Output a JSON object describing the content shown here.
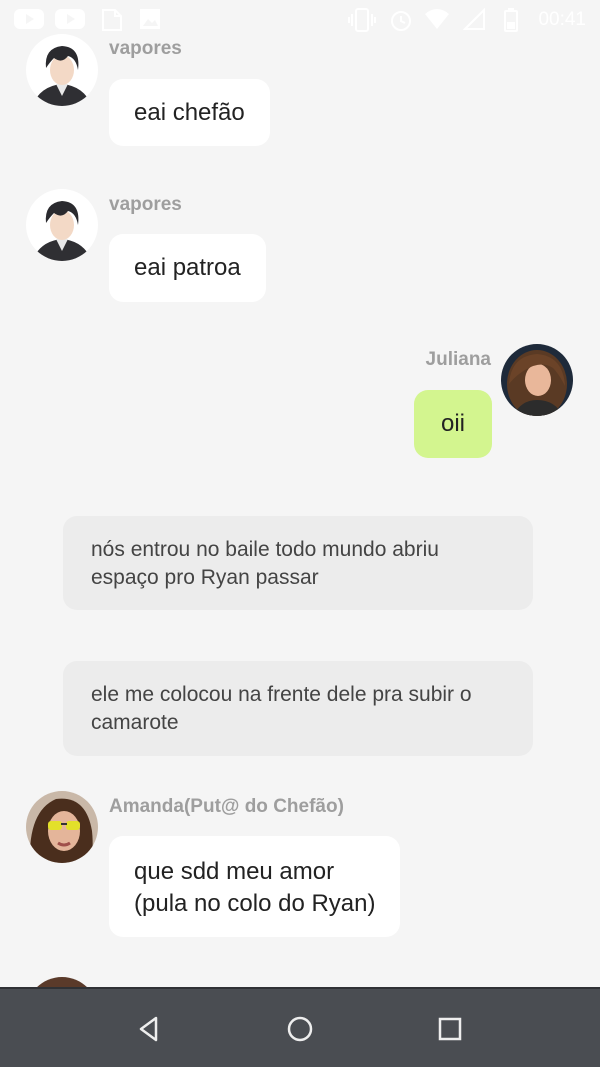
{
  "status_bar": {
    "time": "00:41",
    "icons": [
      "youtube-icon",
      "youtube-icon",
      "file-icon",
      "image-icon",
      "vibrate-icon",
      "alarm-icon",
      "wifi-icon",
      "signal-icon",
      "battery-icon"
    ]
  },
  "messages": [
    {
      "sender": "vapores",
      "text": "eai chefão",
      "side": "left"
    },
    {
      "sender": "vapores",
      "text": "eai patroa",
      "side": "left"
    },
    {
      "sender": "Juliana",
      "text": "oii",
      "side": "right",
      "color": "#d3f58f"
    },
    {
      "narration": "nós entrou no baile todo mundo abriu espaço pro Ryan passar"
    },
    {
      "narration": "ele me colocou na frente dele pra subir o camarote"
    },
    {
      "sender": "Amanda(Put@ do Chefão)",
      "line1": "que sdd meu amor",
      "line2": "(pula no colo do Ryan)",
      "side": "left"
    }
  ],
  "navigation": [
    "back-button",
    "home-button",
    "recents-button"
  ]
}
